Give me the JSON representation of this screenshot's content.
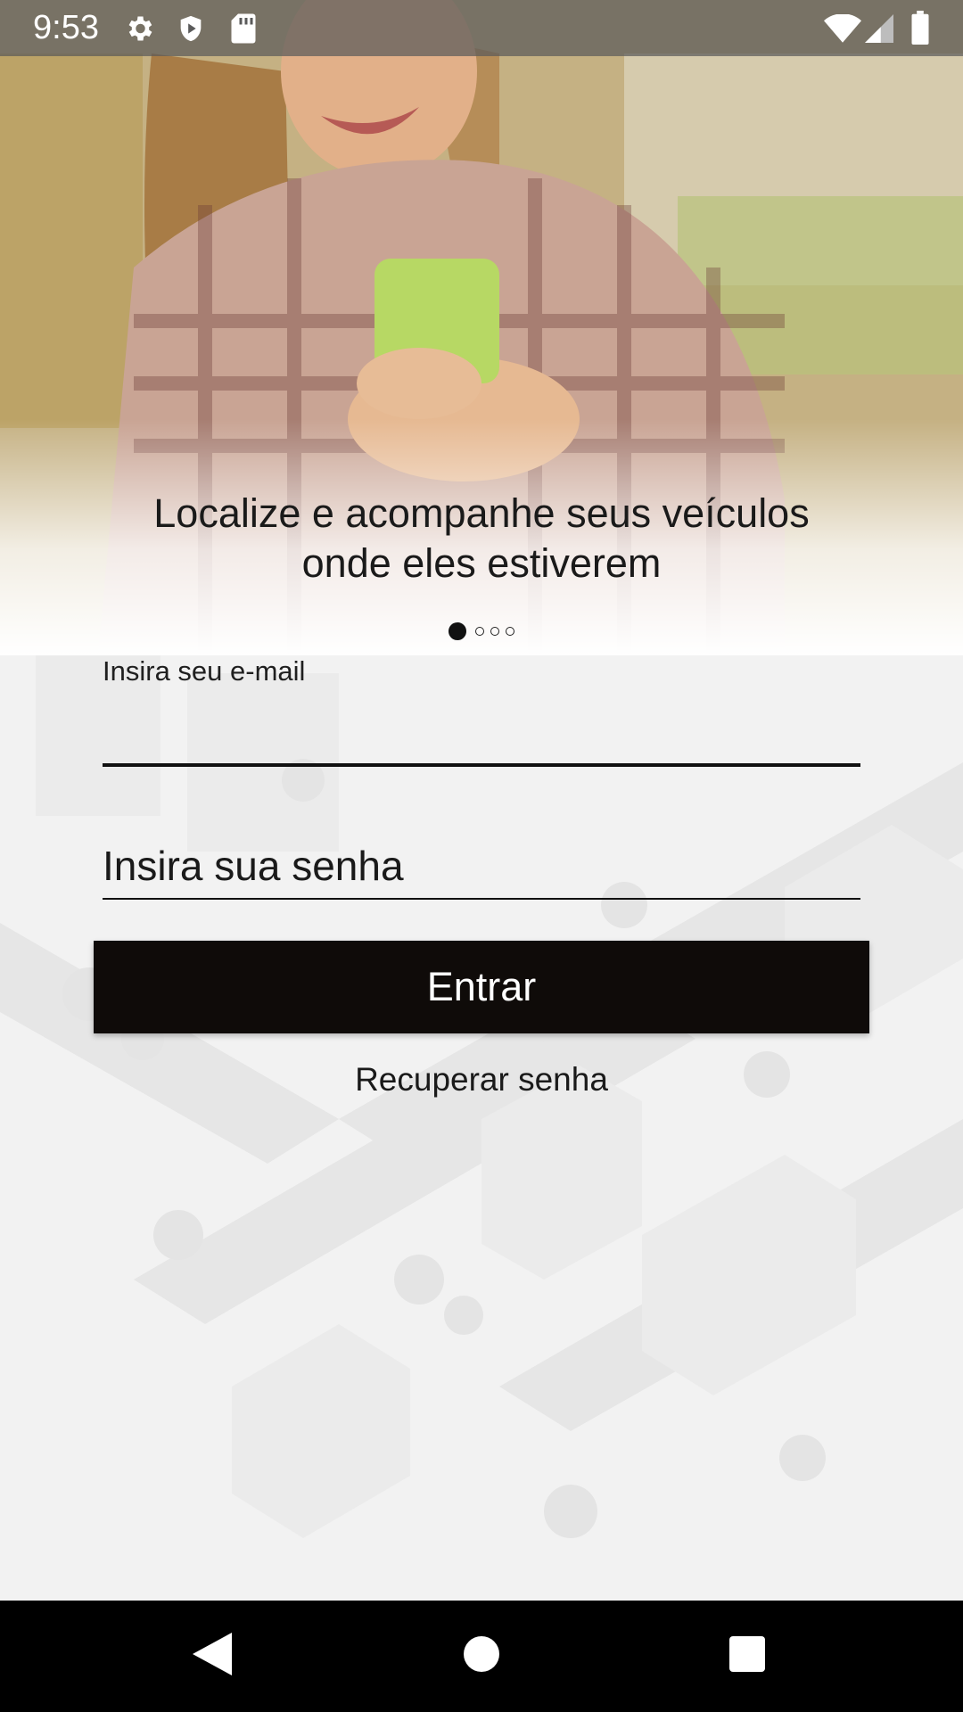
{
  "status_bar": {
    "time": "9:53",
    "left_icons": [
      "gear-icon",
      "shield-icon",
      "sd-card-icon"
    ],
    "right_icons": [
      "wifi-icon",
      "cellular-signal-icon",
      "battery-icon"
    ]
  },
  "hero": {
    "caption": "Localize e acompanhe seus veículos onde eles estiverem",
    "pager": {
      "total": 4,
      "current": 1
    }
  },
  "login_form": {
    "email_label": "Insira seu e-mail",
    "email_value": "",
    "password_placeholder": "Insira sua senha",
    "submit_label": "Entrar",
    "recover_label": "Recuperar senha"
  },
  "nav_bar": {
    "buttons": [
      "back-icon",
      "home-icon",
      "recents-icon"
    ]
  },
  "colors": {
    "button_bg": "#0f0b09",
    "button_text": "#ffffff",
    "nav_bar_bg": "#000000",
    "status_bar_bg": "#5a5a5a"
  }
}
